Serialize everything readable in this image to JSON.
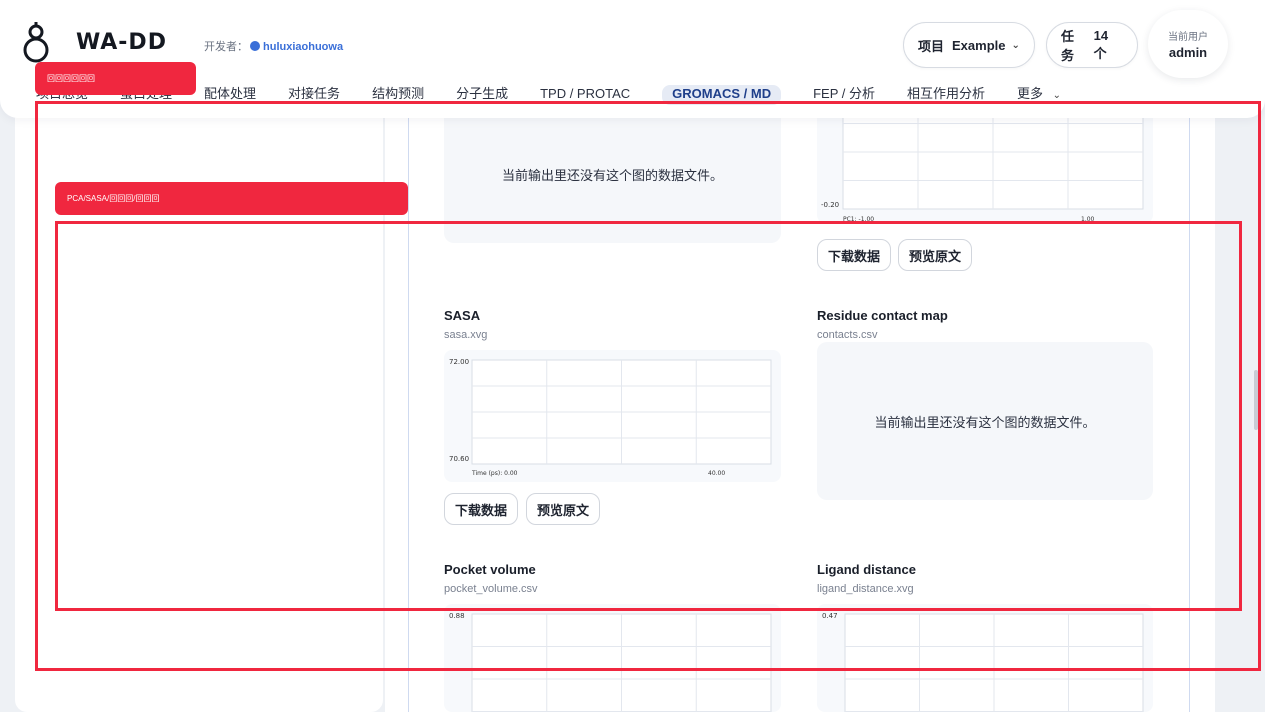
{
  "header": {
    "logo_text": "WA-DD",
    "dev_label": "开发者：",
    "dev_handle": "huluxiaohuowa",
    "project_label": "项目",
    "project_value": "Example",
    "task_label": "任务",
    "task_value": "14 个",
    "user_label": "当前用户",
    "user_name": "admin"
  },
  "nav": {
    "items": [
      "项目总览",
      "蛋白处理",
      "配体处理",
      "对接任务",
      "结构预测",
      "分子生成",
      "TPD / PROTAC",
      "GROMACS / MD",
      "FEP / 分析",
      "相互作用分析"
    ],
    "more": "更多"
  },
  "overlays": {
    "tag_top": "回回回回回回",
    "tag_section": "PCA/SASA/回回回/回回回"
  },
  "cards": {
    "empty_message": "当前输出里还没有这个图的数据文件。",
    "download_label": "下载数据",
    "preview_label": "预览原文",
    "sasa": {
      "title": "SASA",
      "file": "sasa.xvg"
    },
    "contacts": {
      "title": "Residue contact map",
      "file": "contacts.csv"
    },
    "pocket": {
      "title": "Pocket volume",
      "file": "pocket_volume.csv"
    },
    "ligand": {
      "title": "Ligand distance",
      "file": "ligand_distance.xvg"
    }
  },
  "chart_data": [
    {
      "type": "line",
      "title": "",
      "ytick_bottom": "-0.20",
      "xtick_left": "PC1: -1.00",
      "xtick_right": "1.00",
      "ylim_low": -0.2,
      "xlim": [
        -1.0,
        1.0
      ]
    },
    {
      "type": "line",
      "title": "SASA",
      "ytick_top": "72.00",
      "ytick_bottom": "70.60",
      "xtick_left": "Time (ps): 0.00",
      "xtick_right": "40.00",
      "ylim": [
        70.6,
        72.0
      ],
      "xlim": [
        0,
        40
      ]
    },
    {
      "type": "line",
      "title": "Pocket volume",
      "ytick_top": "0.88",
      "ylim_high": 0.88
    },
    {
      "type": "line",
      "title": "Ligand distance",
      "ytick_top": "0.47",
      "ylim_high": 0.47
    }
  ]
}
